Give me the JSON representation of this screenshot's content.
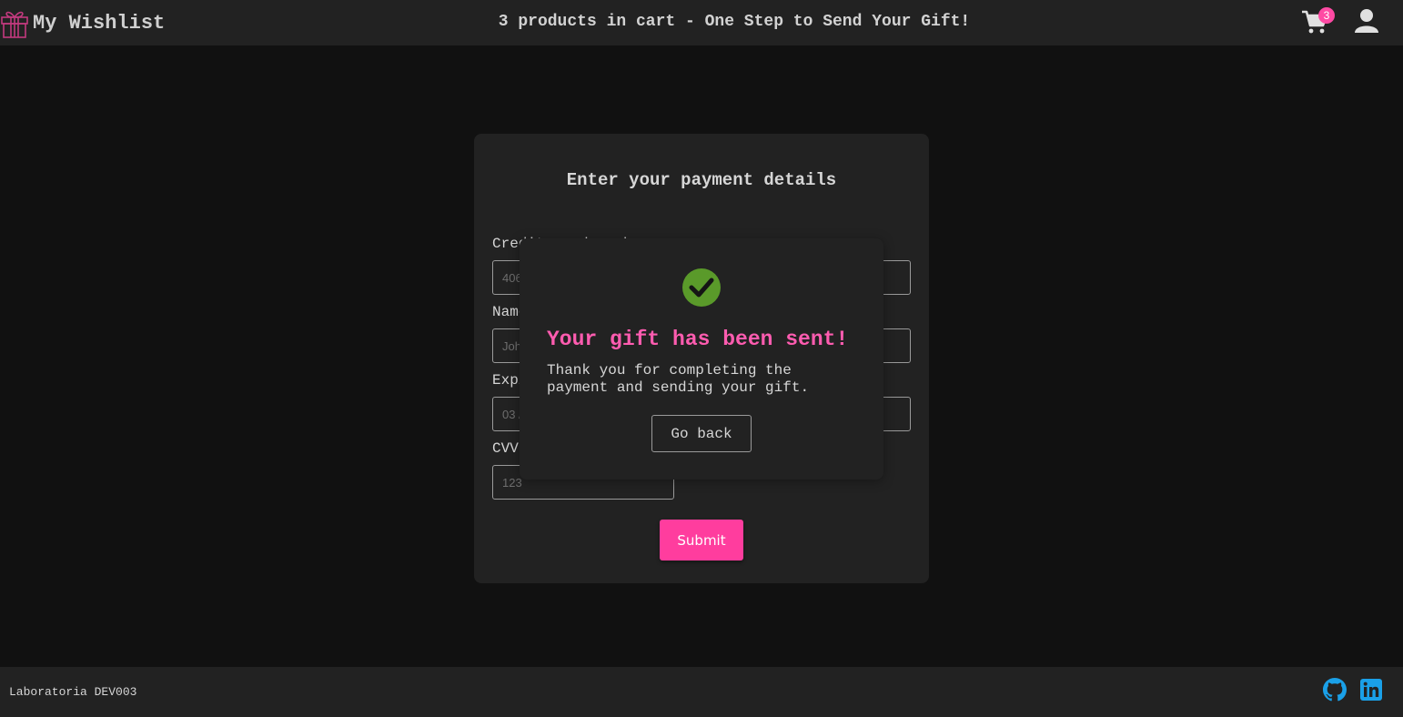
{
  "header": {
    "brand_title": "My Wishlist",
    "message": "3 products in cart - One Step to Send Your Gift!",
    "cart_count": "3",
    "icons": {
      "brand": "gift-icon",
      "cart": "cart-icon",
      "user": "user-icon"
    }
  },
  "form": {
    "title": "Enter your payment details",
    "fields": [
      {
        "label": "Credit card number",
        "placeholder": "4065 0000 0000 0000"
      },
      {
        "label": "Name",
        "placeholder": "John Doe"
      },
      {
        "label": "Expiration date",
        "placeholder": "03 / 26"
      },
      {
        "label": "CVV",
        "placeholder": "123"
      }
    ],
    "submit_label": "Submit"
  },
  "modal": {
    "icon": "check-circle-icon",
    "title": "Your gift has been sent!",
    "text": "Thank you for completing the payment and sending your gift.",
    "button_label": "Go back"
  },
  "footer": {
    "text": "Laboratoria DEV003",
    "icons": [
      "github-icon",
      "linkedin-icon"
    ]
  },
  "colors": {
    "accent": "#ff3d9e",
    "modal_title": "#ff5cb0",
    "success": "#5a9a2a",
    "social": "#1aa0e8",
    "background": "#111111",
    "surface": "#222222"
  }
}
